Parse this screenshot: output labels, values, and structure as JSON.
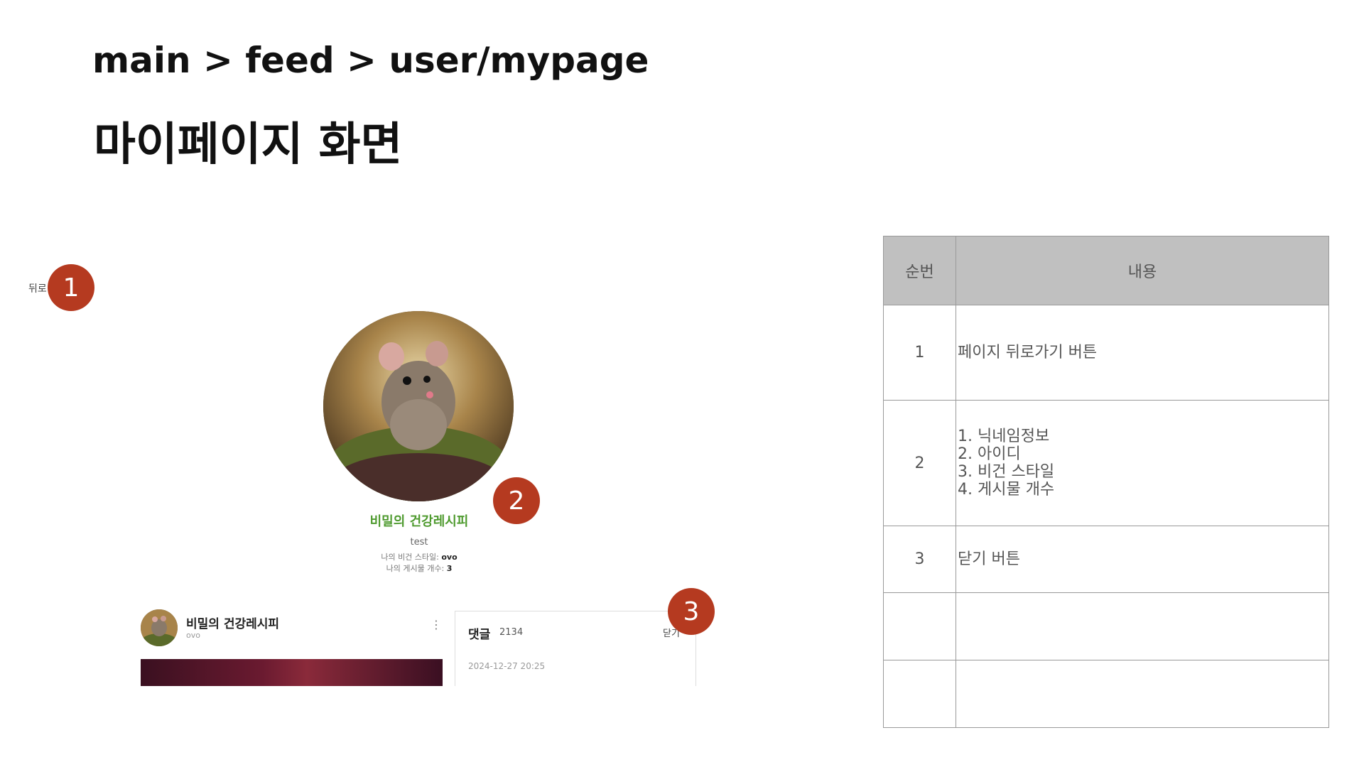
{
  "header": {
    "breadcrumb": "main > feed > user/mypage",
    "title": "마이페이지 화면"
  },
  "mockup": {
    "back_label": "뒤로",
    "profile": {
      "name": "비밀의 건강레시피",
      "id": "test",
      "style_label": "나의 비건 스타일: ",
      "style_value": "ovo",
      "posts_label": "나의 게시물 개수: ",
      "posts_value": "3"
    },
    "post": {
      "author": "비밀의 건강레시피",
      "sub": "ovo",
      "menu_icon": "kebab-icon"
    },
    "comments": {
      "title": "댓글",
      "count": "2134",
      "close_label": "닫기",
      "date": "2024-12-27 20:25"
    }
  },
  "annotations": {
    "badges": [
      "1",
      "2",
      "3"
    ],
    "color": "#b53a20"
  },
  "spec_table": {
    "headers": {
      "num": "순번",
      "content": "내용"
    },
    "rows": [
      {
        "num": "1",
        "lines": [
          "페이지 뒤로가기 버튼"
        ]
      },
      {
        "num": "2",
        "lines": [
          "1. 닉네임정보",
          "2. 아이디",
          "3. 비건 스타일",
          "4. 게시물 개수"
        ]
      },
      {
        "num": "3",
        "lines": [
          "닫기 버튼"
        ]
      },
      {
        "num": "",
        "lines": []
      },
      {
        "num": "",
        "lines": []
      }
    ]
  }
}
